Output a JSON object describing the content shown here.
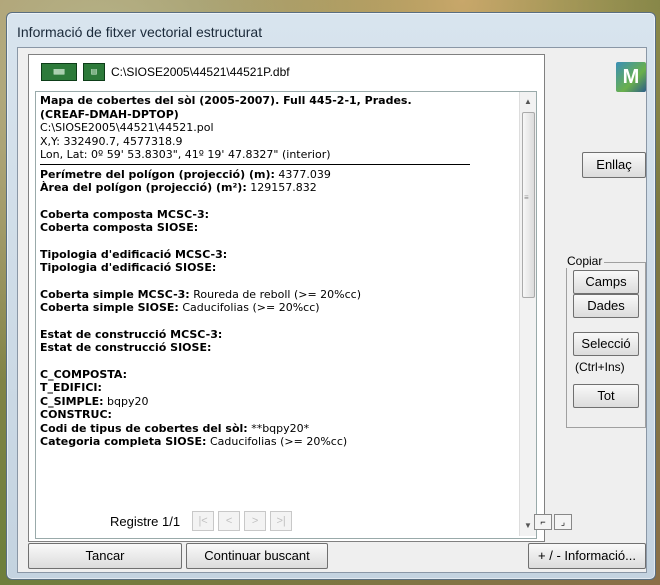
{
  "window": {
    "title": "Informació de fitxer vectorial estructurat"
  },
  "path": {
    "file": "C:\\SIOSE2005\\44521\\44521P.dbf"
  },
  "icons": {
    "dbf_table": "table-icon",
    "dbf_file": "file-icon",
    "app": "miramon-logo"
  },
  "info": {
    "l1": "Mapa de cobertes del sòl (2005-2007). Full 445-2-1, Prades.",
    "l2": "(CREAF-DMAH-DPTOP)",
    "l3": "C:\\SIOSE2005\\44521\\44521.pol",
    "l4": "X,Y: 332490.7, 4577318.9",
    "l5": "Lon, Lat: 0º 59' 53.8303\", 41º 19' 47.8327\" (interior)",
    "per_label": "Perímetre del polígon (projecció) (m):",
    "per_value": "4377.039",
    "area_label": "Àrea del polígon (projecció) (m²):",
    "area_value": "129157.832",
    "cc_mcsc_label": "Coberta composta MCSC-3:",
    "cc_siose_label": "Coberta composta SIOSE:",
    "te_mcsc_label": "Tipologia d'edificació MCSC-3:",
    "te_siose_label": "Tipologia d'edificació SIOSE:",
    "cs_mcsc_label": "Coberta simple MCSC-3:",
    "cs_mcsc_value": "Roureda de reboll (>= 20%cc)",
    "cs_siose_label": "Coberta simple SIOSE:",
    "cs_siose_value": "Caducifolias (>= 20%cc)",
    "ec_mcsc_label": "Estat de construcció MCSC-3:",
    "ec_siose_label": "Estat de construcció SIOSE:",
    "f1_label": "C_COMPOSTA:",
    "f2_label": "T_EDIFICI:",
    "f3_label": "C_SIMPLE:",
    "f3_value": "bqpy20",
    "f4_label": "CONSTRUC:",
    "f5_label": "Codi de tipus de cobertes del sòl:",
    "f5_value": "**bqpy20*",
    "f6_label": "Categoria completa SIOSE:",
    "f6_value": "Caducifolias (>= 20%cc)"
  },
  "nav": {
    "record_label": "Registre 1/1",
    "first": "|<",
    "prev": "<",
    "next": ">",
    "last": ">|"
  },
  "buttons": {
    "link": "Enllaç",
    "copy_group": "Copiar",
    "fields": "Camps",
    "data": "Dades",
    "selection": "Selecció",
    "shortcut": "(Ctrl+Ins)",
    "all": "Tot",
    "close": "Tancar",
    "continue": "Continuar buscant",
    "more_info": "+ / - Informació..."
  }
}
